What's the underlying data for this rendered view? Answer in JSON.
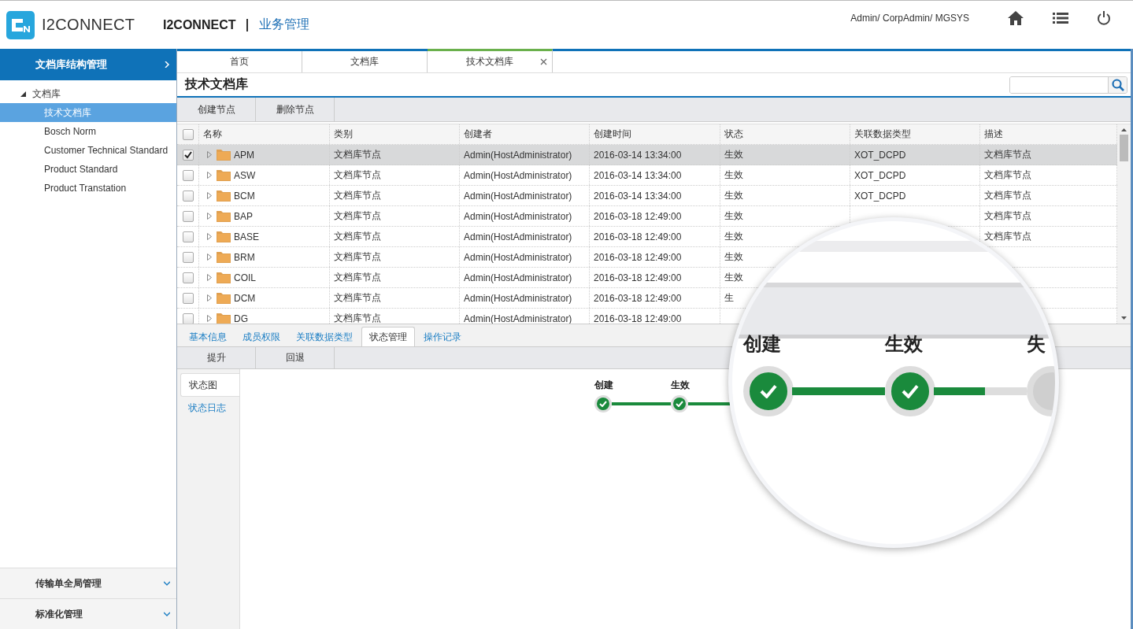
{
  "header": {
    "brand": "I2CONNECT",
    "app_name": "I2CONNECT",
    "module": "业务管理",
    "user": "Admin/ CorpAdmin/ MGSYS"
  },
  "sidebar": {
    "sections": [
      {
        "label": "文档库结构管理",
        "expanded": true,
        "tree": [
          {
            "label": "文档库",
            "expanded": true,
            "selected": false,
            "children": [
              {
                "label": "技术文档库",
                "selected": true
              },
              {
                "label": "Bosch Norm",
                "selected": false
              },
              {
                "label": "Customer Technical Standard",
                "selected": false
              },
              {
                "label": "Product Standard",
                "selected": false
              },
              {
                "label": "Product Transtation",
                "selected": false
              }
            ]
          }
        ]
      },
      {
        "label": "传输单全局管理",
        "expanded": false
      },
      {
        "label": "标准化管理",
        "expanded": false
      }
    ]
  },
  "tabs": [
    {
      "label": "首页",
      "selected": false,
      "closable": false
    },
    {
      "label": "文档库",
      "selected": false,
      "closable": false
    },
    {
      "label": "技术文档库",
      "selected": true,
      "closable": true
    }
  ],
  "page_title": "技术文档库",
  "toolbar": [
    "创建节点",
    "删除节点"
  ],
  "table": {
    "all_checked": false,
    "columns": [
      "名称",
      "类别",
      "创建者",
      "创建时间",
      "状态",
      "关联数据类型",
      "描述"
    ],
    "rows": [
      {
        "checked": true,
        "selected": true,
        "cells": [
          "APM",
          "文档库节点",
          "Admin(HostAdministrator)",
          "2016-03-14 13:34:00",
          "生效",
          "XOT_DCPD",
          "文档库节点"
        ]
      },
      {
        "checked": false,
        "selected": false,
        "cells": [
          "ASW",
          "文档库节点",
          "Admin(HostAdministrator)",
          "2016-03-14 13:34:00",
          "生效",
          "XOT_DCPD",
          "文档库节点"
        ]
      },
      {
        "checked": false,
        "selected": false,
        "cells": [
          "BCM",
          "文档库节点",
          "Admin(HostAdministrator)",
          "2016-03-14 13:34:00",
          "生效",
          "XOT_DCPD",
          "文档库节点"
        ]
      },
      {
        "checked": false,
        "selected": false,
        "cells": [
          "BAP",
          "文档库节点",
          "Admin(HostAdministrator)",
          "2016-03-18 12:49:00",
          "生效",
          "",
          "文档库节点"
        ]
      },
      {
        "checked": false,
        "selected": false,
        "cells": [
          "BASE",
          "文档库节点",
          "Admin(HostAdministrator)",
          "2016-03-18 12:49:00",
          "生效",
          "",
          "文档库节点"
        ]
      },
      {
        "checked": false,
        "selected": false,
        "cells": [
          "BRM",
          "文档库节点",
          "Admin(HostAdministrator)",
          "2016-03-18 12:49:00",
          "生效",
          "",
          ""
        ]
      },
      {
        "checked": false,
        "selected": false,
        "cells": [
          "COIL",
          "文档库节点",
          "Admin(HostAdministrator)",
          "2016-03-18 12:49:00",
          "生效",
          "",
          ""
        ]
      },
      {
        "checked": false,
        "selected": false,
        "cells": [
          "DCM",
          "文档库节点",
          "Admin(HostAdministrator)",
          "2016-03-18 12:49:00",
          "生",
          "",
          ""
        ]
      },
      {
        "checked": false,
        "selected": false,
        "cells": [
          "DG",
          "文档库节点",
          "Admin(HostAdministrator)",
          "2016-03-18 12:49:00",
          "",
          "",
          ""
        ]
      }
    ]
  },
  "detail_tabs": [
    {
      "label": "基本信息",
      "selected": false
    },
    {
      "label": "成员权限",
      "selected": false
    },
    {
      "label": "关联数据类型",
      "selected": false
    },
    {
      "label": "状态管理",
      "selected": true
    },
    {
      "label": "操作记录",
      "selected": false
    }
  ],
  "detail_toolbar": [
    "提升",
    "回退"
  ],
  "side_tabs": [
    {
      "label": "状态图",
      "selected": true
    },
    {
      "label": "状态日志",
      "selected": false
    }
  ],
  "lifecycle": [
    {
      "label": "创建",
      "done": true
    },
    {
      "label": "生效",
      "done": true
    }
  ],
  "magnifier": {
    "stages": [
      {
        "label": "创建",
        "done": true
      },
      {
        "label": "生效",
        "done": true
      },
      {
        "label": "失",
        "done": false
      }
    ]
  }
}
